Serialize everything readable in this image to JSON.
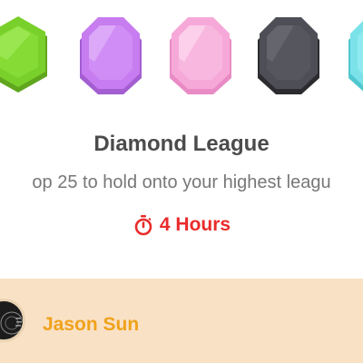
{
  "badges": [
    {
      "name": "green-league-badge",
      "color": "#7ad02b"
    },
    {
      "name": "purple-league-badge",
      "color": "#c77cf0"
    },
    {
      "name": "pink-league-badge",
      "color": "#f6a9d8"
    },
    {
      "name": "black-league-badge",
      "color": "#4e4e56"
    },
    {
      "name": "teal-league-badge",
      "color": "#7ce2e9"
    }
  ],
  "league": {
    "title": "Diamond League",
    "subtitle": "op 25 to hold onto your highest leagu"
  },
  "timer": {
    "icon": "stopwatch-icon",
    "label": "4 Hours"
  },
  "leaderboard": {
    "rows": [
      {
        "name": "Jason Sun",
        "avatar_icon": "avatar"
      }
    ]
  },
  "colors": {
    "timer": "#ea2b2b",
    "highlight_row": "#f9e1c6",
    "user_name": "#f0a21b"
  }
}
